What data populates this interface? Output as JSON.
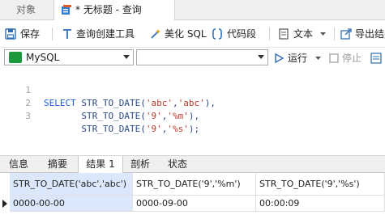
{
  "tabs": {
    "objects": "对象",
    "query": "* 无标题 - 查询"
  },
  "toolbar": {
    "save": "保存",
    "query_builder": "查询创建工具",
    "beautify": "美化 SQL",
    "snippet": "代码段",
    "text": "文本",
    "export": "导出结果"
  },
  "connection": {
    "selected": "MySQL",
    "database": ""
  },
  "actions": {
    "run": "运行",
    "stop": "停止"
  },
  "editor": {
    "lines": [
      {
        "num": "1",
        "kw": "SELECT ",
        "fn": "STR_TO_DATE(",
        "a": "'abc'",
        "mid": ",",
        "b": "'abc'",
        "end": "),"
      },
      {
        "num": "2",
        "kw": "       ",
        "fn": "STR_TO_DATE(",
        "a": "'9'",
        "mid": ",",
        "b": "'%m'",
        "end": "),"
      },
      {
        "num": "3",
        "kw": "       ",
        "fn": "STR_TO_DATE(",
        "a": "'9'",
        "mid": ",",
        "b": "'%s'",
        "end": ");"
      }
    ]
  },
  "result_tabs": [
    "信息",
    "摘要",
    "结果 1",
    "剖析",
    "状态"
  ],
  "result": {
    "columns": [
      "STR_TO_DATE('abc','abc')",
      "STR_TO_DATE('9','%m')",
      "STR_TO_DATE('9','%s')"
    ],
    "rows": [
      [
        "0000-00-00",
        "0000-09-00",
        "00:00:09"
      ]
    ]
  },
  "colors": {
    "keyword": "#1d5bd8",
    "string": "#c03a2f",
    "selection": "#dbe8fb"
  }
}
